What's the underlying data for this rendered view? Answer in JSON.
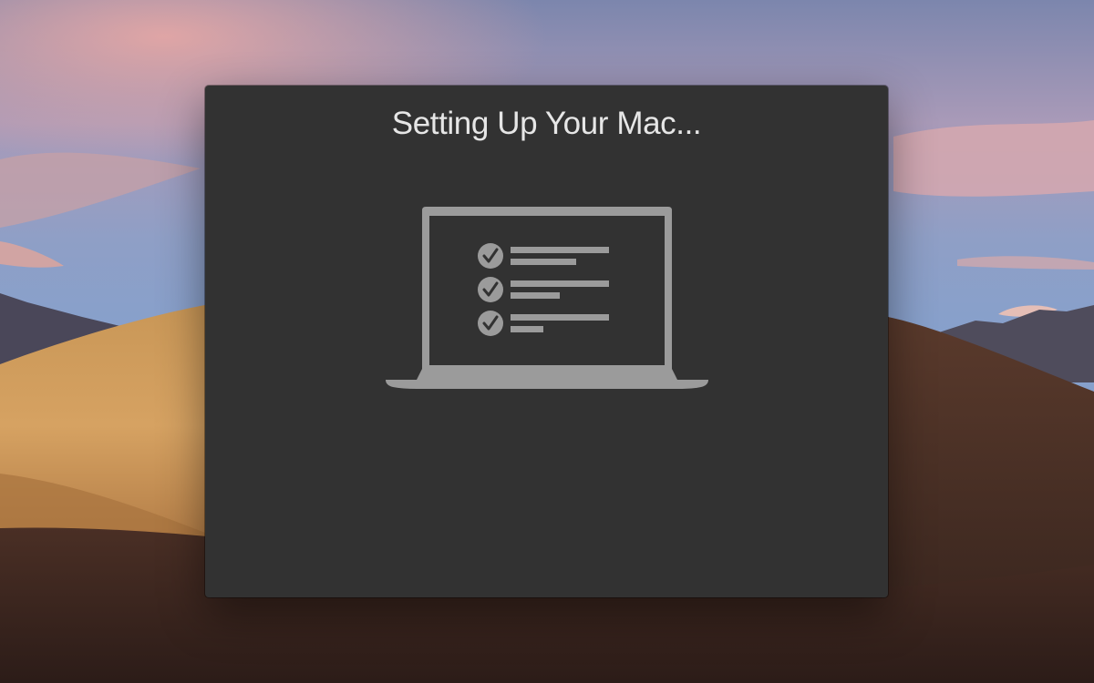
{
  "window": {
    "title": "Setting Up Your Mac..."
  },
  "illustration": {
    "icon": "laptop-checklist-icon",
    "checklist_items": 3,
    "checked_items": 3
  },
  "colors": {
    "window_background": "#323232",
    "title_text": "#e6e6e6",
    "illustration": "#9b9b9b"
  }
}
